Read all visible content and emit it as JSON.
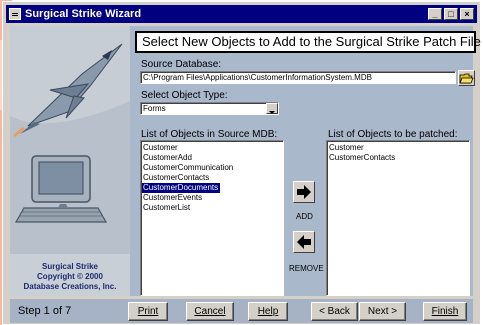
{
  "window": {
    "title": "Surgical Strike Wizard"
  },
  "title_buttons": {
    "minimize": "_",
    "maximize": "□",
    "close": "×"
  },
  "heading": "Select New Objects to Add to the Surgical Strike Patch File",
  "source_db": {
    "label": "Source Database:",
    "value": "C:\\Program Files\\Applications\\CustomerInformationSystem.MDB"
  },
  "object_type": {
    "label": "Select Object Type:",
    "value": "Forms"
  },
  "source_list": {
    "label": "List of Objects in Source MDB:",
    "items": [
      "Customer",
      "CustomerAdd",
      "CustomerCommunication",
      "CustomerContacts",
      "CustomerDocuments",
      "CustomerEvents",
      "CustomerList"
    ],
    "selected_index": 4
  },
  "patch_list": {
    "label": "List of Objects to be patched:",
    "items": [
      "Customer",
      "CustomerContacts"
    ]
  },
  "add_label": "ADD",
  "remove_label": "REMOVE",
  "credits": {
    "line1": "Surgical Strike",
    "line2": "Copyright © 2000",
    "line3": "Database Creations, Inc."
  },
  "footer": {
    "step": "Step 1 of 7",
    "print": "Print",
    "cancel": "Cancel",
    "help": "Help",
    "back": "< Back",
    "next": "Next >",
    "finish": "Finish"
  }
}
